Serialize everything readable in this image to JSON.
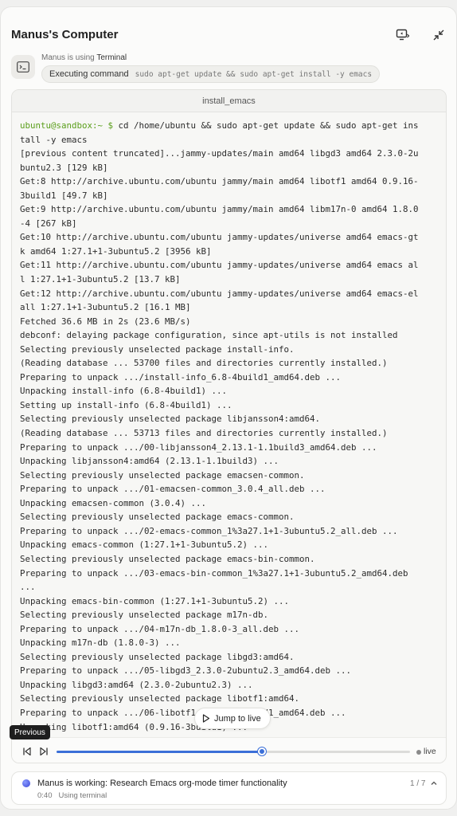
{
  "window": {
    "title": "Manus's Computer"
  },
  "status": {
    "using_prefix": "Manus is using",
    "tool_name": "Terminal",
    "action_label": "Executing command",
    "command": "sudo apt-get update && sudo apt-get install -y emacs"
  },
  "terminal": {
    "title": "install_emacs",
    "prompt": "ubuntu@sandbox:~ $",
    "first_line_rest": " cd /home/ubuntu && sudo apt-get update && sudo apt-get ins",
    "lines": [
      "tall -y emacs",
      "[previous content truncated]...jammy-updates/main amd64 libgd3 amd64 2.3.0-2u",
      "buntu2.3 [129 kB]",
      "Get:8 http://archive.ubuntu.com/ubuntu jammy/main amd64 libotf1 amd64 0.9.16-",
      "3build1 [49.7 kB]",
      "Get:9 http://archive.ubuntu.com/ubuntu jammy/main amd64 libm17n-0 amd64 1.8.0",
      "-4 [267 kB]",
      "Get:10 http://archive.ubuntu.com/ubuntu jammy-updates/universe amd64 emacs-gt",
      "k amd64 1:27.1+1-3ubuntu5.2 [3956 kB]",
      "Get:11 http://archive.ubuntu.com/ubuntu jammy-updates/universe amd64 emacs al",
      "l 1:27.1+1-3ubuntu5.2 [13.7 kB]",
      "Get:12 http://archive.ubuntu.com/ubuntu jammy-updates/universe amd64 emacs-el",
      "all 1:27.1+1-3ubuntu5.2 [16.1 MB]",
      "Fetched 36.6 MB in 2s (23.6 MB/s)",
      "debconf: delaying package configuration, since apt-utils is not installed",
      "Selecting previously unselected package install-info.",
      "(Reading database ... 53700 files and directories currently installed.)",
      "Preparing to unpack .../install-info_6.8-4build1_amd64.deb ...",
      "Unpacking install-info (6.8-4build1) ...",
      "Setting up install-info (6.8-4build1) ...",
      "Selecting previously unselected package libjansson4:amd64.",
      "(Reading database ... 53713 files and directories currently installed.)",
      "Preparing to unpack .../00-libjansson4_2.13.1-1.1build3_amd64.deb ...",
      "Unpacking libjansson4:amd64 (2.13.1-1.1build3) ...",
      "Selecting previously unselected package emacsen-common.",
      "Preparing to unpack .../01-emacsen-common_3.0.4_all.deb ...",
      "Unpacking emacsen-common (3.0.4) ...",
      "Selecting previously unselected package emacs-common.",
      "Preparing to unpack .../02-emacs-common_1%3a27.1+1-3ubuntu5.2_all.deb ...",
      "Unpacking emacs-common (1:27.1+1-3ubuntu5.2) ...",
      "Selecting previously unselected package emacs-bin-common.",
      "Preparing to unpack .../03-emacs-bin-common_1%3a27.1+1-3ubuntu5.2_amd64.deb",
      "...",
      "Unpacking emacs-bin-common (1:27.1+1-3ubuntu5.2) ...",
      "Selecting previously unselected package m17n-db.",
      "Preparing to unpack .../04-m17n-db_1.8.0-3_all.deb ...",
      "Unpacking m17n-db (1.8.0-3) ...",
      "Selecting previously unselected package libgd3:amd64.",
      "Preparing to unpack .../05-libgd3_2.3.0-2ubuntu2.3_amd64.deb ...",
      "Unpacking libgd3:amd64 (2.3.0-2ubuntu2.3) ...",
      "Selecting previously unselected package libotf1:amd64.",
      "Preparing to unpack .../06-libotf1_0.9.16-3build1_amd64.deb ...",
      "Unpacking libotf1:amd64 (0.9.16-3build1) ..."
    ]
  },
  "playback": {
    "progress": 0.58,
    "live_label": "live",
    "jump_label": "Jump to live",
    "tooltip": "Previous"
  },
  "task": {
    "title": "Manus is working: Research Emacs org-mode timer functionality",
    "elapsed": "0:40",
    "activity": "Using terminal",
    "counter": "1 / 7"
  },
  "colors": {
    "accent": "#3b6fd8",
    "prompt": "#5a9e1a"
  }
}
